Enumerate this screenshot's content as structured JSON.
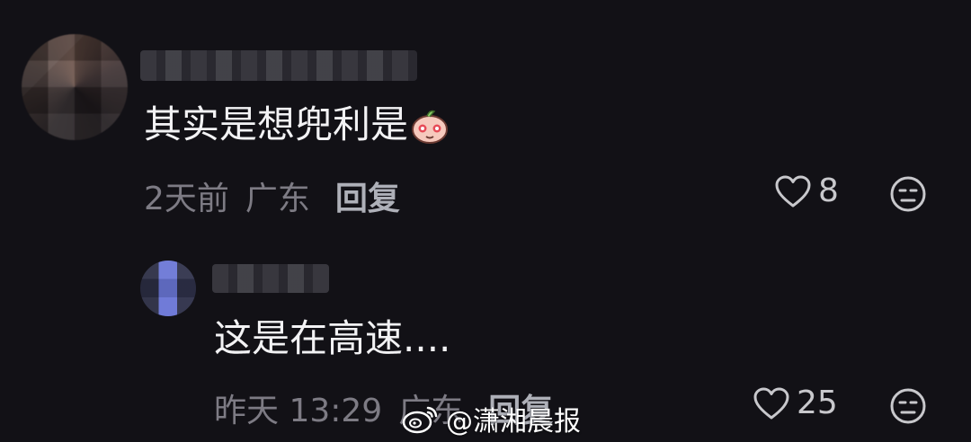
{
  "comments": [
    {
      "text": "其实是想兜利是",
      "time": "2天前",
      "location": "广东",
      "reply_label": "回复",
      "likes": "8",
      "emoji": "blushing-peach-emoji"
    },
    {
      "text": "这是在高速....",
      "time": "昨天 13:29",
      "location": "广东",
      "reply_label": "回复",
      "likes": "25"
    }
  ],
  "watermark": {
    "text": "@潇湘晨报",
    "icon": "weibo-icon"
  },
  "colors": {
    "background": "#121116",
    "text_primary": "#f2f2f4",
    "text_secondary": "#7d7b84",
    "reply_button": "#aeb0b8"
  }
}
